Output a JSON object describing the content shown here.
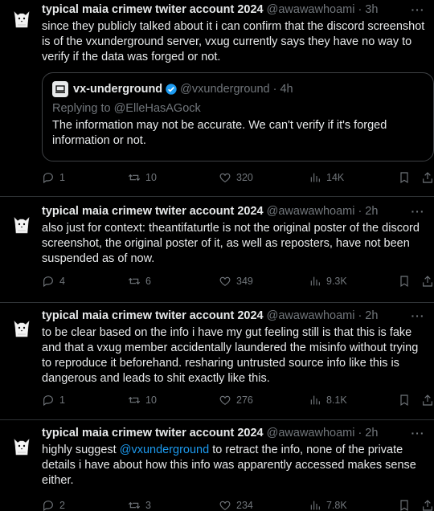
{
  "tweets": [
    {
      "author": "typical maia crimew twiter account 2024",
      "handle": "@awawawhoami",
      "time": "3h",
      "text": "since they publicly talked about it i can confirm that the discord screenshot is of the vxunderground server, vxug currently says they have no way to verify if the data was forged or not.",
      "quote": {
        "author": "vx-underground",
        "handle": "@vxunderground",
        "time": "4h",
        "replying_prefix": "Replying to ",
        "replying_to": "@ElleHasAGock",
        "text": "The information may not be accurate. We can't verify if it's forged information or not."
      },
      "replies": "1",
      "retweets": "10",
      "likes": "320",
      "views": "14K"
    },
    {
      "author": "typical maia crimew twiter account 2024",
      "handle": "@awawawhoami",
      "time": "2h",
      "text": "also just for context: theantifaturtle is not the original poster of the discord screenshot, the original poster of it, as well as reposters, have not been suspended as of now.",
      "replies": "4",
      "retweets": "6",
      "likes": "349",
      "views": "9.3K"
    },
    {
      "author": "typical maia crimew twiter account 2024",
      "handle": "@awawawhoami",
      "time": "2h",
      "text": "to be clear based on the info i have my gut feeling still is that this is fake and that a vxug member accidentally laundered the misinfo without trying to reproduce it beforehand. resharing untrusted source info like this is dangerous and leads to shit exactly like this.",
      "replies": "1",
      "retweets": "10",
      "likes": "276",
      "views": "8.1K"
    },
    {
      "author": "typical maia crimew twiter account 2024",
      "handle": "@awawawhoami",
      "time": "2h",
      "text_before": "highly suggest ",
      "text_mention": "@vxunderground",
      "text_after": " to retract the info, none of the private details i have about how this info was apparently accessed makes sense either.",
      "replies": "2",
      "retweets": "3",
      "likes": "234",
      "views": "7.8K"
    }
  ],
  "ui": {
    "dot": "·",
    "more": "···"
  },
  "colors": {
    "background": "#000000",
    "text": "#e7e9ea",
    "muted": "#71767b",
    "accent": "#1d9bf0",
    "border": "#2f3336"
  },
  "icons": [
    "cat-avatar-icon",
    "more-icon",
    "verified-badge-icon",
    "reply-icon",
    "retweet-icon",
    "like-icon",
    "views-icon",
    "bookmark-icon",
    "share-icon"
  ]
}
